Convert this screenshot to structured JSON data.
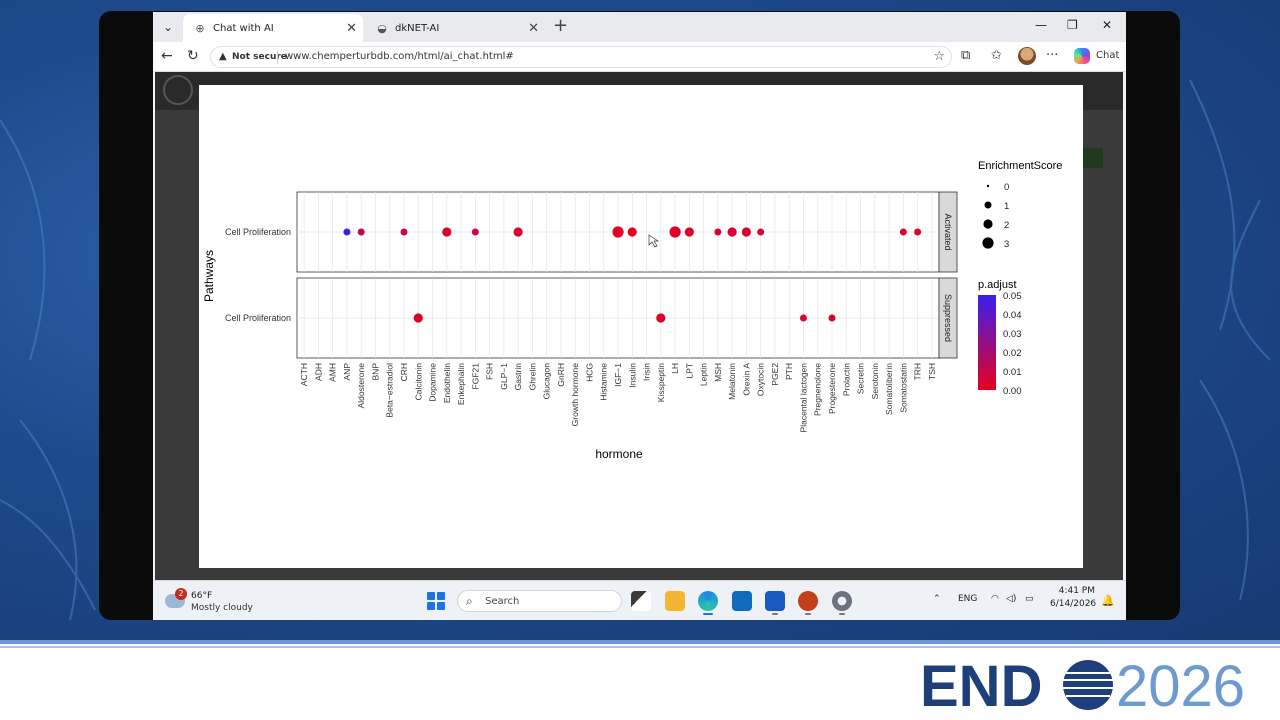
{
  "browser": {
    "tabs": [
      {
        "title": "Chat with AI",
        "active": true
      },
      {
        "title": "dkNET-AI",
        "active": false
      }
    ],
    "security_label": "Not secure",
    "url": "www.chemperturbdb.com/html/ai_chat.html#",
    "copilot_label": "Chat"
  },
  "chart_data": {
    "type": "scatter",
    "xlabel": "hormone",
    "ylabel": "Pathways",
    "categories": [
      "ACTH",
      "ADH",
      "AMH",
      "ANP",
      "Aldosterone",
      "BNP",
      "Beta−estradiol",
      "CRH",
      "Calcitonin",
      "Dopamine",
      "Endothelin",
      "Enkephalin",
      "FGF21",
      "FSH",
      "GLP−1",
      "Gastrin",
      "Ghrelin",
      "Glucagon",
      "GnRH",
      "Growth hormone",
      "HCG",
      "Histamine",
      "IGF−1",
      "Insulin",
      "Irisin",
      "Kisspeptin",
      "LH",
      "LPT",
      "Leptin",
      "MSH",
      "Melatonin",
      "Orexin A",
      "Oxytocin",
      "PGE2",
      "PTH",
      "Placental lactogen",
      "Pregnenolone",
      "Progesterone",
      "Prolactin",
      "Secretin",
      "Serotonin",
      "Somatoliberin",
      "Somatostatin",
      "TRH",
      "TSH"
    ],
    "facets": [
      {
        "label": "Activated",
        "row_label": "Cell Proliferation",
        "points": [
          {
            "x": "ANP",
            "score": 1,
            "p_adjust": 0.048
          },
          {
            "x": "Aldosterone",
            "score": 1,
            "p_adjust": 0.012
          },
          {
            "x": "CRH",
            "score": 1,
            "p_adjust": 0.008
          },
          {
            "x": "Endothelin",
            "score": 2,
            "p_adjust": 0.004
          },
          {
            "x": "FGF21",
            "score": 1,
            "p_adjust": 0.008
          },
          {
            "x": "Gastrin",
            "score": 2,
            "p_adjust": 0.004
          },
          {
            "x": "IGF−1",
            "score": 3,
            "p_adjust": 0.002
          },
          {
            "x": "Insulin",
            "score": 2,
            "p_adjust": 0.002
          },
          {
            "x": "LH",
            "score": 3,
            "p_adjust": 0.002
          },
          {
            "x": "LPT",
            "score": 2,
            "p_adjust": 0.004
          },
          {
            "x": "MSH",
            "score": 1,
            "p_adjust": 0.006
          },
          {
            "x": "Melatonin",
            "score": 2,
            "p_adjust": 0.004
          },
          {
            "x": "Orexin A",
            "score": 2,
            "p_adjust": 0.004
          },
          {
            "x": "Oxytocin",
            "score": 1,
            "p_adjust": 0.006
          },
          {
            "x": "Somatostatin",
            "score": 1,
            "p_adjust": 0.004
          },
          {
            "x": "TRH",
            "score": 1,
            "p_adjust": 0.004
          }
        ]
      },
      {
        "label": "Suppressed",
        "row_label": "Cell Proliferation",
        "points": [
          {
            "x": "Calcitonin",
            "score": 2,
            "p_adjust": 0.002
          },
          {
            "x": "Kisspeptin",
            "score": 2,
            "p_adjust": 0.002
          },
          {
            "x": "Placental lactogen",
            "score": 1,
            "p_adjust": 0.004
          },
          {
            "x": "Progesterone",
            "score": 1,
            "p_adjust": 0.004
          }
        ]
      }
    ],
    "size_legend": {
      "title": "EnrichmentScore",
      "values": [
        0,
        1,
        2,
        3
      ]
    },
    "color_legend": {
      "title": "p.adjust",
      "ticks": [
        "0.05",
        "0.04",
        "0.03",
        "0.02",
        "0.01",
        "0.00"
      ],
      "low_color": "#e8001e",
      "high_color": "#3a1ff0"
    },
    "grid": true
  },
  "taskbar": {
    "weather_badge": "2",
    "temperature": "66°F",
    "condition": "Mostly cloudy",
    "search_label": "Search",
    "language": "ENG",
    "time": "4:41 PM",
    "date": "6/14/2026"
  },
  "branding": {
    "logo_text": "ENDO2026",
    "colors": {
      "navy": "#1f3f7a",
      "light": "#6d9bd1"
    }
  }
}
